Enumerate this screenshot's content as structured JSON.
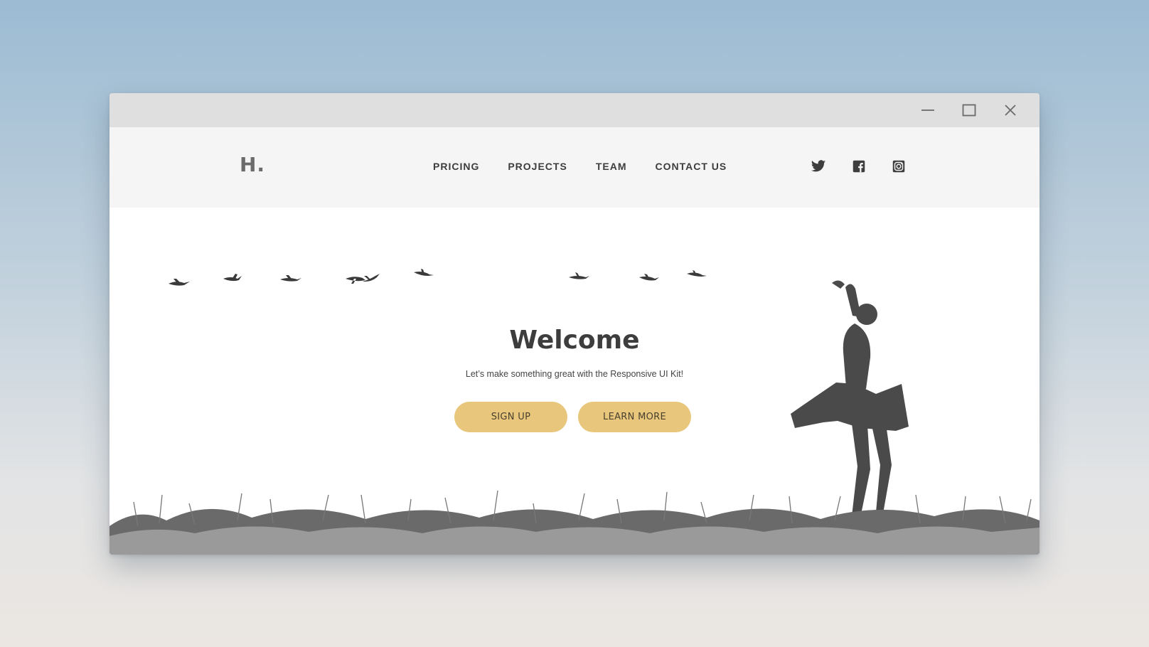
{
  "window": {
    "controls": {
      "minimize": "minimize-icon",
      "maximize": "maximize-icon",
      "close": "close-icon"
    }
  },
  "header": {
    "logo": "H.",
    "nav": [
      {
        "label": "PRICING"
      },
      {
        "label": "PROJECTS"
      },
      {
        "label": "TEAM"
      },
      {
        "label": "CONTACT US"
      }
    ],
    "social": [
      "twitter-icon",
      "facebook-icon",
      "instagram-icon"
    ]
  },
  "hero": {
    "title": "Welcome",
    "subtitle": "Let’s make something great with the Responsive UI Kit!",
    "primary_button": "SIGN UP",
    "secondary_button": "LEARN MORE",
    "image": "grayscale photo: dancer in skirt in grass field, birds in flight"
  },
  "colors": {
    "accent": "#e8c77d",
    "text_dark": "#3d3d3d",
    "navbar_bg": "#f5f5f5",
    "titlebar_bg": "#dfdfdf"
  }
}
